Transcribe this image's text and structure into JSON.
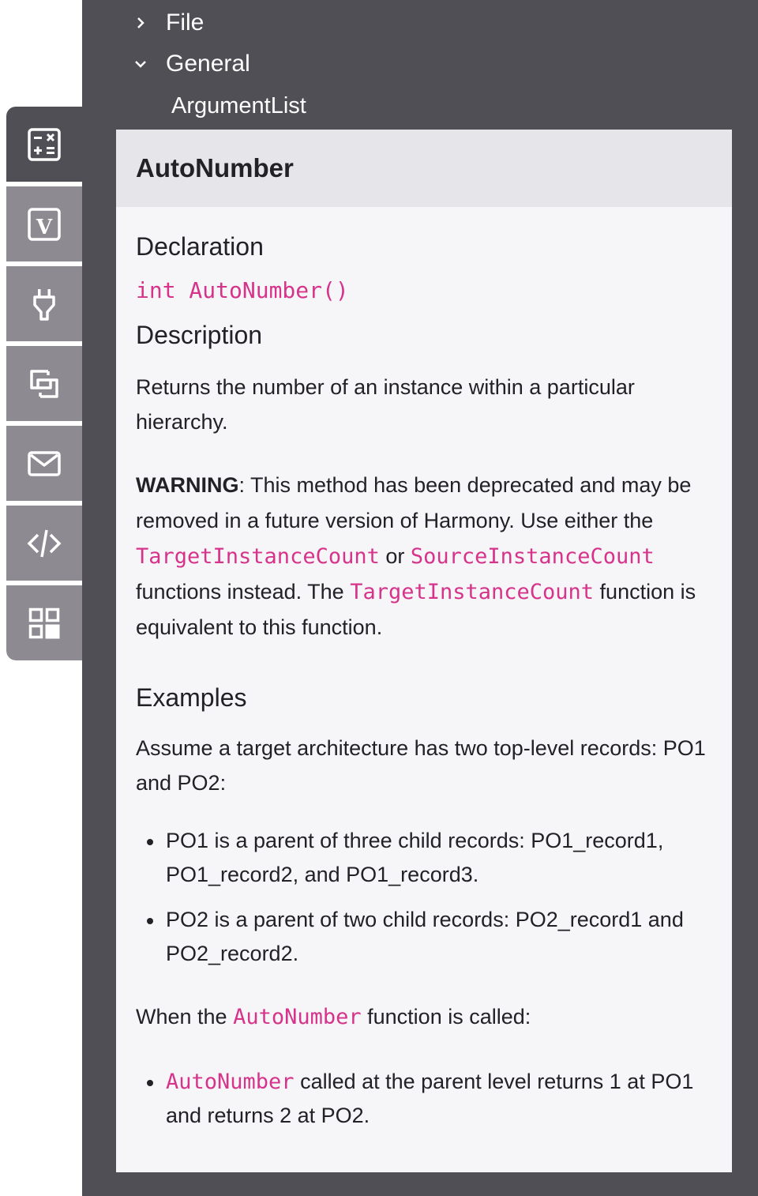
{
  "tree": {
    "items": [
      {
        "label": "File",
        "expanded": false
      },
      {
        "label": "General",
        "expanded": true
      },
      {
        "label": "ArgumentList",
        "child": true
      }
    ]
  },
  "toolbar": {
    "tools": [
      {
        "icon": "calculator-icon",
        "tooltip": "Functions",
        "active": true
      },
      {
        "icon": "variable-icon",
        "tooltip": "Variables",
        "active": false
      },
      {
        "icon": "plug-icon",
        "tooltip": "Plugins",
        "active": false
      },
      {
        "icon": "link-objects-icon",
        "tooltip": "Objects",
        "active": false
      },
      {
        "icon": "mail-icon",
        "tooltip": "Notifications",
        "active": false
      },
      {
        "icon": "code-icon",
        "tooltip": "Scripts",
        "active": false
      },
      {
        "icon": "grid-icon",
        "tooltip": "Components",
        "active": false
      }
    ]
  },
  "doc": {
    "title": "AutoNumber",
    "declaration_heading": "Declaration",
    "declaration": "int AutoNumber()",
    "description_heading": "Description",
    "description": "Returns the number of an instance within a particular hierarchy.",
    "warning": {
      "label": "WARNING",
      "text1": ": This method has been deprecated and may be removed in a future version of Harmony. Use either the ",
      "code1": "TargetInstanceCount",
      "text2": " or ",
      "code2": "SourceInstanceCount",
      "text3": " functions instead. The ",
      "code3": "TargetInstanceCount",
      "text4": " function is equivalent to this function."
    },
    "examples_heading": "Examples",
    "examples_intro": "Assume a target architecture has two top-level records: PO1 and PO2:",
    "records": [
      "PO1 is a parent of three child records: PO1_record1, PO1_record2, and PO1_record3.",
      "PO2 is a parent of two child records: PO2_record1 and PO2_record2."
    ],
    "called_intro": {
      "text1": "When the ",
      "code": "AutoNumber",
      "text2": " function is called:"
    },
    "results": [
      {
        "code": "AutoNumber",
        "text": " called at the parent level returns 1 at PO1 and returns 2 at PO2."
      }
    ]
  },
  "colors": {
    "code_accent": "#d6338a",
    "panel_dark": "#504f55",
    "toolbar_inactive": "#8d8a91"
  }
}
